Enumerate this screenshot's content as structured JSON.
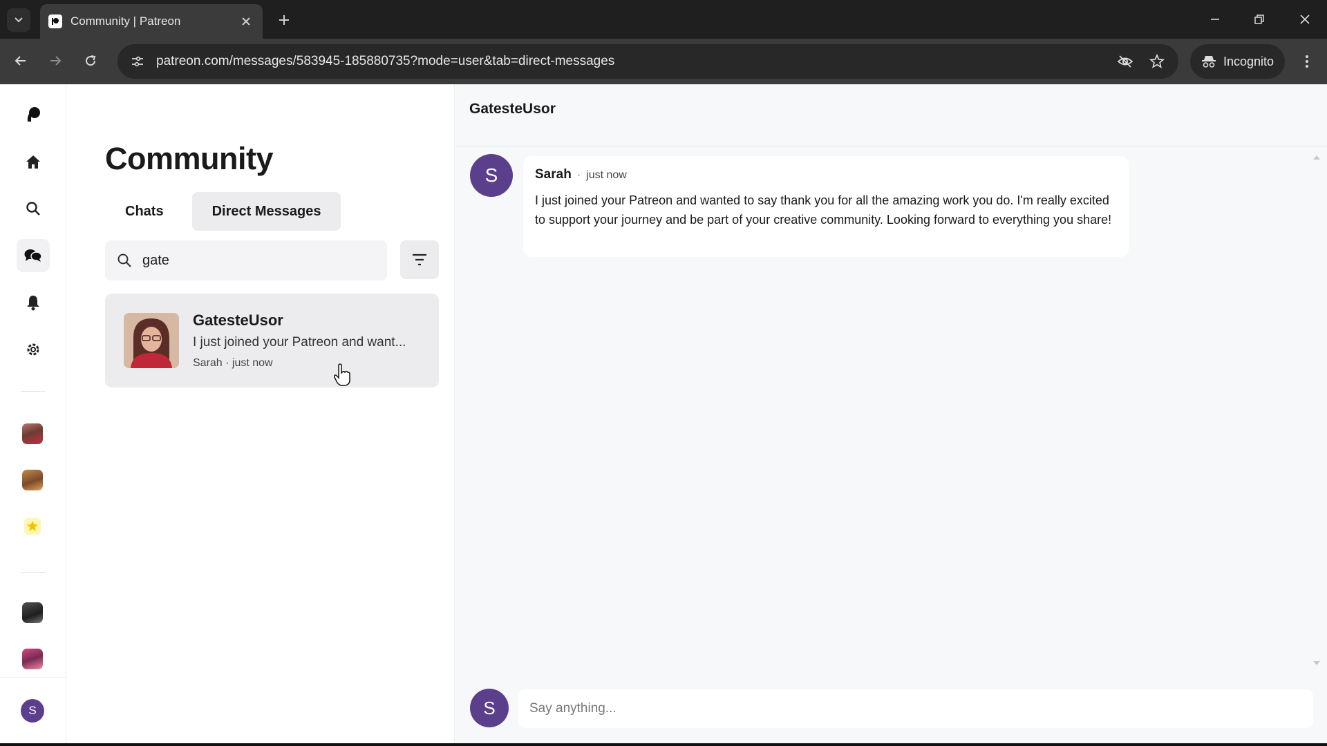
{
  "browser": {
    "tab_title": "Community | Patreon",
    "url": "patreon.com/messages/583945-185880735?mode=user&tab=direct-messages",
    "incognito_label": "Incognito"
  },
  "rail": {
    "user_initial": "S"
  },
  "list": {
    "title": "Community",
    "tabs": [
      {
        "label": "Chats",
        "active": false
      },
      {
        "label": "Direct Messages",
        "active": true
      }
    ],
    "search_value": "gate",
    "conversations": [
      {
        "name": "GatesteUsor",
        "preview": "I just joined your Patreon and want...",
        "meta": "Sarah · just now"
      }
    ]
  },
  "chat": {
    "title": "GatesteUsor",
    "messages": [
      {
        "author_initial": "S",
        "author": "Sarah",
        "separator": "·",
        "time": "just now",
        "text": "I just joined your Patreon and wanted to say thank you for all the amazing work you do. I'm really excited to support your journey and be part of your creative community. Looking forward to everything you share!"
      }
    ],
    "composer_initial": "S",
    "composer_placeholder": "Say anything..."
  },
  "colors": {
    "avatar_purple": "#5b3f8c",
    "chrome_dark": "#1f1f1f",
    "chrome_toolbar": "#3b3b3b"
  }
}
